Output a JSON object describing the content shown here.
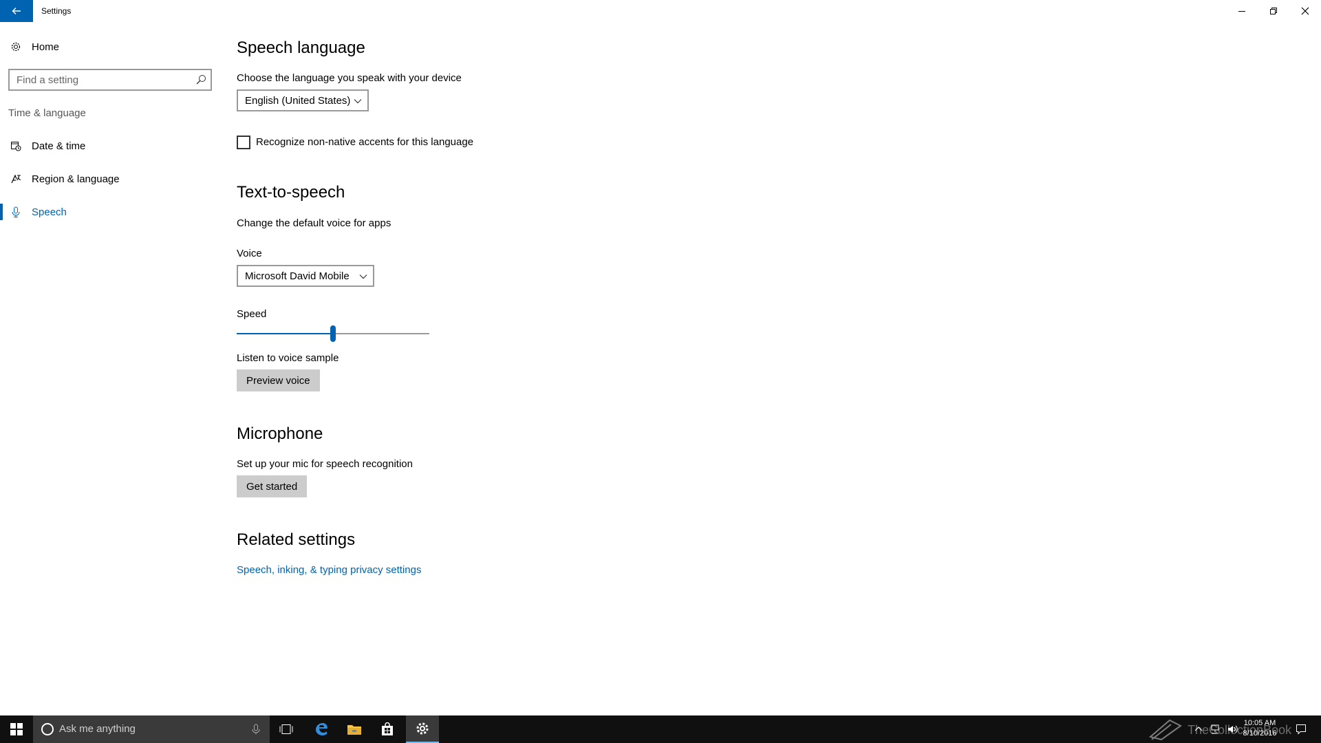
{
  "window": {
    "title": "Settings"
  },
  "sidebar": {
    "home_label": "Home",
    "search_placeholder": "Find a setting",
    "group_label": "Time & language",
    "items": [
      {
        "label": "Date & time",
        "icon": "calendar-clock-icon"
      },
      {
        "label": "Region & language",
        "icon": "region-language-icon"
      },
      {
        "label": "Speech",
        "icon": "microphone-icon",
        "active": true
      }
    ]
  },
  "speech_language": {
    "heading": "Speech language",
    "description": "Choose the language you speak with your device",
    "language_value": "English (United States)",
    "accent_checkbox_label": "Recognize non-native accents for this language",
    "accent_checked": false
  },
  "tts": {
    "heading": "Text-to-speech",
    "description": "Change the default voice for apps",
    "voice_label": "Voice",
    "voice_value": "Microsoft David Mobile",
    "speed_label": "Speed",
    "speed_fraction": 0.5,
    "sample_label": "Listen to voice sample",
    "preview_button": "Preview voice"
  },
  "microphone": {
    "heading": "Microphone",
    "description": "Set up your mic for speech recognition",
    "get_started_button": "Get started"
  },
  "related": {
    "heading": "Related settings",
    "privacy_link": "Speech, inking, & typing privacy settings"
  },
  "taskbar": {
    "search_placeholder": "Ask me anything",
    "time": "10:05 AM",
    "date": "8/10/2016",
    "watermark": "TheCollectionBook"
  },
  "colors": {
    "accent": "#0063b1",
    "taskbar": "#101010"
  }
}
